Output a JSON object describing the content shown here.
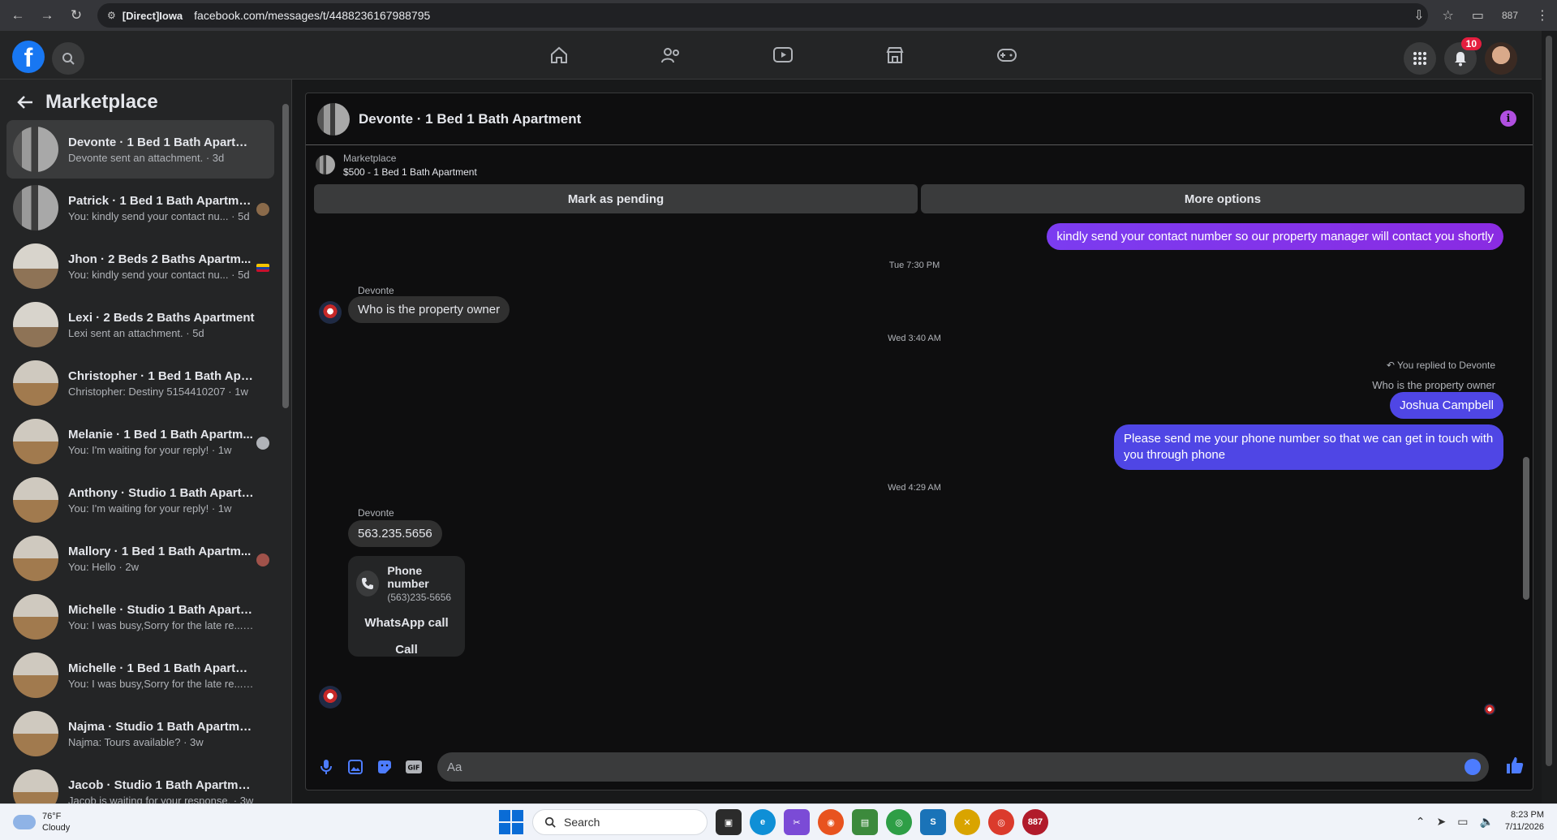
{
  "browser": {
    "site_tag": "[Direct]Iowa",
    "url": "facebook.com/messages/t/4488236167988795",
    "tab_count": "887"
  },
  "topnav": {
    "notifications_badge": "10"
  },
  "sidebar": {
    "title": "Marketplace",
    "conversations": [
      {
        "name": "Devonte · 1 Bed 1 Bath Apartment",
        "preview": "Devonte sent an attachment. · 3d",
        "active": true
      },
      {
        "name": "Patrick · 1 Bed 1 Bath Apartme...",
        "preview": "You: kindly send your contact nu... · 5d"
      },
      {
        "name": "Jhon · 2 Beds 2 Baths Apartm...",
        "preview": "You: kindly send your contact nu... · 5d"
      },
      {
        "name": "Lexi · 2 Beds 2 Baths Apartment",
        "preview": "Lexi sent an attachment. · 5d"
      },
      {
        "name": "Christopher · 1 Bed 1 Bath Apart...",
        "preview": "Christopher: Destiny 5154410207 · 1w"
      },
      {
        "name": "Melanie · 1 Bed 1 Bath Apartm...",
        "preview": "You: I'm waiting for your reply! · 1w"
      },
      {
        "name": "Anthony · Studio 1 Bath Apartm...",
        "preview": "You: I'm waiting for your reply! · 1w"
      },
      {
        "name": "Mallory · 1 Bed 1 Bath Apartm...",
        "preview": "You: Hello · 2w"
      },
      {
        "name": "Michelle · Studio 1 Bath Apartm...",
        "preview": "You: I was busy,Sorry for the late re... · 2w"
      },
      {
        "name": "Michelle · 1 Bed 1 Bath Apartment",
        "preview": "You: I was busy,Sorry for the late re... · 2w"
      },
      {
        "name": "Najma · Studio 1 Bath Apartment",
        "preview": "Najma: Tours available? · 3w"
      },
      {
        "name": "Jacob · Studio 1 Bath Apartment",
        "preview": "Jacob is waiting for your response. · 3w"
      }
    ]
  },
  "chat": {
    "title": "Devonte · 1 Bed 1 Bath Apartment",
    "listing_source": "Marketplace",
    "listing_title": "$500 - 1 Bed 1 Bath Apartment",
    "mark_pending_label": "Mark as pending",
    "more_options_label": "More options",
    "messages": {
      "out_1": "kindly send your contact number so our property manager will contact you shortly",
      "time_1": "Tue 7:30 PM",
      "sender_1": "Devonte",
      "in_1": "Who is the property owner",
      "time_2": "Wed 3:40 AM",
      "reply_note": "You replied to Devonte",
      "reply_quote": "Who is the property owner",
      "out_2": "Joshua Campbell",
      "out_3": "Please send me your phone  number so that we can get in touch with you through phone",
      "time_3": "Wed 4:29 AM",
      "sender_2": "Devonte",
      "in_2": "563.235.5656"
    },
    "phone_card": {
      "label": "Phone number",
      "number": "(563)235-5656",
      "whatsapp": "WhatsApp call",
      "call": "Call"
    },
    "composer_placeholder": "Aa"
  },
  "taskbar": {
    "temp": "76°F",
    "condition": "Cloudy",
    "search_label": "Search",
    "badge_app": "887",
    "time": "8:23 PM",
    "date": "7/11/2026"
  }
}
